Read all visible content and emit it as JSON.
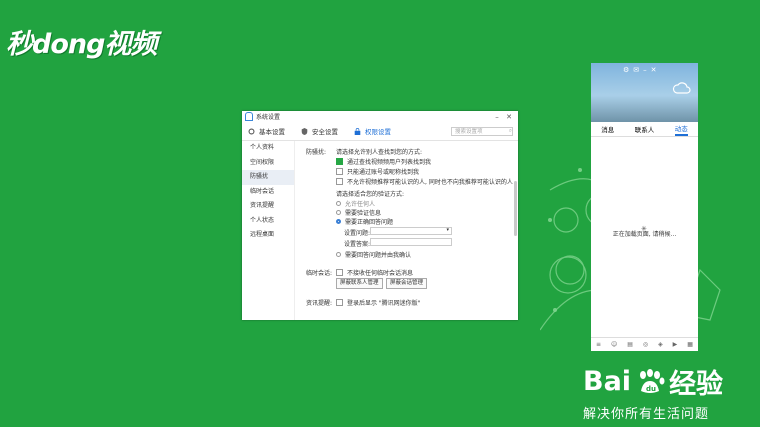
{
  "brand": {
    "logo_text": "秒dong视频"
  },
  "watermark": {
    "brand": "Bai",
    "brand2": "经验",
    "slogan": "解决你所有生活问题"
  },
  "window": {
    "title": "系统设置",
    "tabs": [
      {
        "label": "基本设置"
      },
      {
        "label": "安全设置"
      },
      {
        "label": "权限设置"
      }
    ],
    "search_placeholder": "搜索设置项",
    "nav": [
      "个人资料",
      "空间权限",
      "防骚扰",
      "临时会话",
      "资讯提醒",
      "个人状态",
      "远程桌面"
    ],
    "section_label": "防骚扰:",
    "find_title": "请选择允许别人查找到您的方式:",
    "find_options": [
      {
        "label": "通过查找视频频用户列表找到我",
        "checked": true
      },
      {
        "label": "只能通过账号或昵称找到我",
        "checked": false
      },
      {
        "label": "不允许视频推荐可能认识的人, 同时也不向我推荐可能认识的人",
        "checked": false
      }
    ],
    "verify_title": "请选择适合您的验证方式:",
    "verify_options": [
      {
        "label": "允许任何人",
        "selected": false
      },
      {
        "label": "需要验证信息",
        "selected": false
      },
      {
        "label": "需要正确回答问题",
        "selected": true
      }
    ],
    "question_label": "设置问题:",
    "answer_label": "设置答案:",
    "answer_confirm": "需要回答问题并由我确认",
    "temp_label": "临时会话:",
    "temp_option": "不接收任何临时会话消息",
    "btn_contacts": "屏蔽联系人管理",
    "btn_sessions": "屏蔽会话管理",
    "news_label": "资讯提醒:",
    "news_option": "登录后显示 \"腾讯网迷你版\""
  },
  "qq": {
    "tabs": [
      "消息",
      "联系人",
      "动态"
    ],
    "loading": "正在加载页面, 请稍候..."
  }
}
